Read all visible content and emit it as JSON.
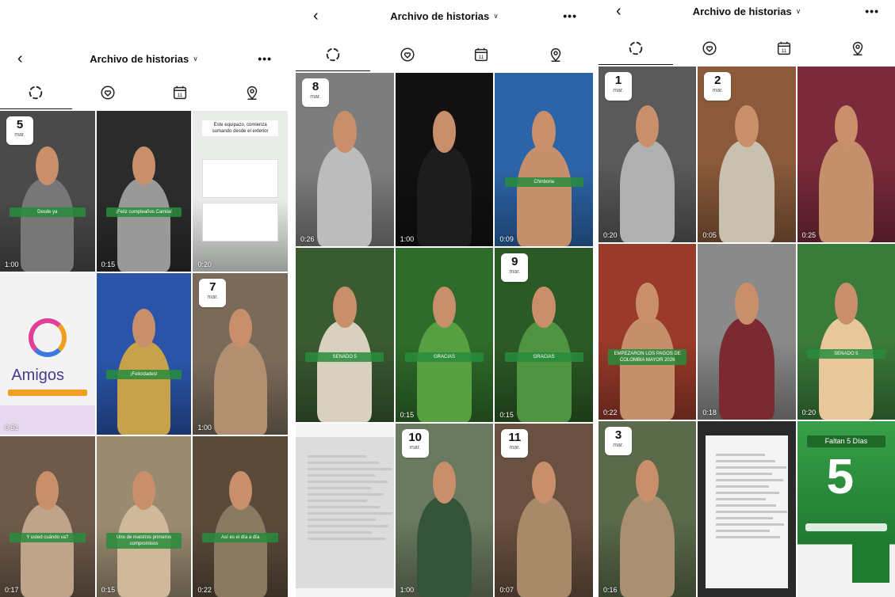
{
  "header": {
    "title": "Archivo de historias",
    "back_icon": "chevron-left-icon",
    "more_icon": "more-icon",
    "title_chevron": "chevron-down-icon"
  },
  "tabs": [
    {
      "icon": "stories-ring-icon",
      "active": true
    },
    {
      "icon": "heart-circle-icon",
      "active": false
    },
    {
      "icon": "calendar-icon",
      "active": false
    },
    {
      "icon": "location-pin-icon",
      "active": false
    }
  ],
  "calendar_glyph": "11",
  "panels": [
    {
      "tiles": [
        {
          "date_day": "5",
          "date_month": "mar.",
          "duration": "1:00",
          "caption": "Desde ya",
          "bg": "#4a4a4a",
          "fg": "#777"
        },
        {
          "date_day": "",
          "date_month": "",
          "duration": "0:15",
          "caption": "¡Feliz cumpleaños Camila!",
          "bg": "#2b2b2b",
          "fg": "#999"
        },
        {
          "date_day": "",
          "date_month": "",
          "duration": "0:20",
          "caption": "Este equipazo, comienza sumando desde el exterior",
          "bg": "#e9ece8",
          "fg": "#9fbf97",
          "light": true
        },
        {
          "date_day": "",
          "date_month": "",
          "duration": "0:51",
          "caption": "",
          "bg": "#f3f3f3",
          "fg": "#e8e8e8",
          "logo": true
        },
        {
          "date_day": "",
          "date_month": "",
          "duration": "",
          "caption": "¡Felicidades!",
          "bg": "#2a54a8",
          "fg": "#c7a24a"
        },
        {
          "date_day": "7",
          "date_month": "mar.",
          "duration": "1:00",
          "caption": "",
          "bg": "#7a6a5a",
          "fg": "#b28f70"
        },
        {
          "date_day": "",
          "date_month": "",
          "duration": "0:17",
          "caption": "Y usted cuándo va?",
          "bg": "#6d5a4a",
          "fg": "#bfa38a"
        },
        {
          "date_day": "",
          "date_month": "",
          "duration": "0:15",
          "caption": "Uno de nuestros primeros compromisos",
          "bg": "#9a8a70",
          "fg": "#d0b89a"
        },
        {
          "date_day": "",
          "date_month": "",
          "duration": "0:22",
          "caption": "Así es el día a día",
          "bg": "#5a4a3a",
          "fg": "#8a7a62"
        }
      ]
    },
    {
      "tiles": [
        {
          "date_day": "8",
          "date_month": "mar.",
          "duration": "0:26",
          "caption": "",
          "bg": "#7d7d7d",
          "fg": "#bcbcbc"
        },
        {
          "date_day": "",
          "date_month": "",
          "duration": "1:00",
          "caption": "",
          "bg": "#111",
          "fg": "#1d1d1d"
        },
        {
          "date_day": "",
          "date_month": "",
          "duration": "0:09",
          "caption": "Chinboria",
          "bg": "#2c64a8",
          "fg": "#c58f6c"
        },
        {
          "date_day": "",
          "date_month": "",
          "duration": "",
          "caption": "SENADO 5",
          "bg": "#3a5a32",
          "fg": "#d8d1c0"
        },
        {
          "date_day": "",
          "date_month": "",
          "duration": "0:15",
          "caption": "GRACIAS",
          "bg": "#2f6b2a",
          "fg": "#56a042"
        },
        {
          "date_day": "9",
          "date_month": "mar.",
          "duration": "0:15",
          "caption": "GRACIAS",
          "bg": "#2c5a26",
          "fg": "#4f9440"
        },
        {
          "date_day": "",
          "date_month": "",
          "duration": "",
          "caption": "",
          "bg": "#f4f4f4",
          "fg": "#dcdcdc",
          "doc": true
        },
        {
          "date_day": "10",
          "date_month": "mar.",
          "duration": "1:00",
          "caption": "",
          "bg": "#6a7a60",
          "fg": "#34543a"
        },
        {
          "date_day": "11",
          "date_month": "mar.",
          "duration": "0:07",
          "caption": "",
          "bg": "#6a5040",
          "fg": "#a88a6a"
        }
      ]
    },
    {
      "tiles": [
        {
          "date_day": "1",
          "date_month": "mar.",
          "duration": "0:20",
          "caption": "",
          "bg": "#5a5a5a",
          "fg": "#b0b0b0"
        },
        {
          "date_day": "2",
          "date_month": "mar.",
          "duration": "0:05",
          "caption": "",
          "bg": "#8a5a3a",
          "fg": "#c9c1b0"
        },
        {
          "date_day": "",
          "date_month": "",
          "duration": "0:25",
          "caption": "",
          "bg": "#7a2a3a",
          "fg": "#c58f6c"
        },
        {
          "date_day": "",
          "date_month": "",
          "duration": "0:22",
          "caption": "EMPEZARON LOS PAGOS DE COLOMBIA MAYOR 2026",
          "bg": "#9a3a2a",
          "fg": "#c58f6c"
        },
        {
          "date_day": "",
          "date_month": "",
          "duration": "0:18",
          "caption": "",
          "bg": "#8a8a8a",
          "fg": "#7a2a30"
        },
        {
          "date_day": "",
          "date_month": "",
          "duration": "0:20",
          "caption": "SENADO 5",
          "bg": "#3a7a3a",
          "fg": "#e8c89a"
        },
        {
          "date_day": "3",
          "date_month": "mar.",
          "duration": "0:16",
          "caption": "",
          "bg": "#5a6a4a",
          "fg": "#a89070"
        },
        {
          "date_day": "",
          "date_month": "",
          "duration": "",
          "caption": "",
          "bg": "#2a2a2a",
          "fg": "#f4f4f4",
          "doc": true
        },
        {
          "date_day": "",
          "date_month": "",
          "duration": "",
          "caption": "Faltan 5 Días",
          "bg": "#2e8a3a",
          "fg": "#ffffff",
          "poster": true
        }
      ]
    }
  ]
}
